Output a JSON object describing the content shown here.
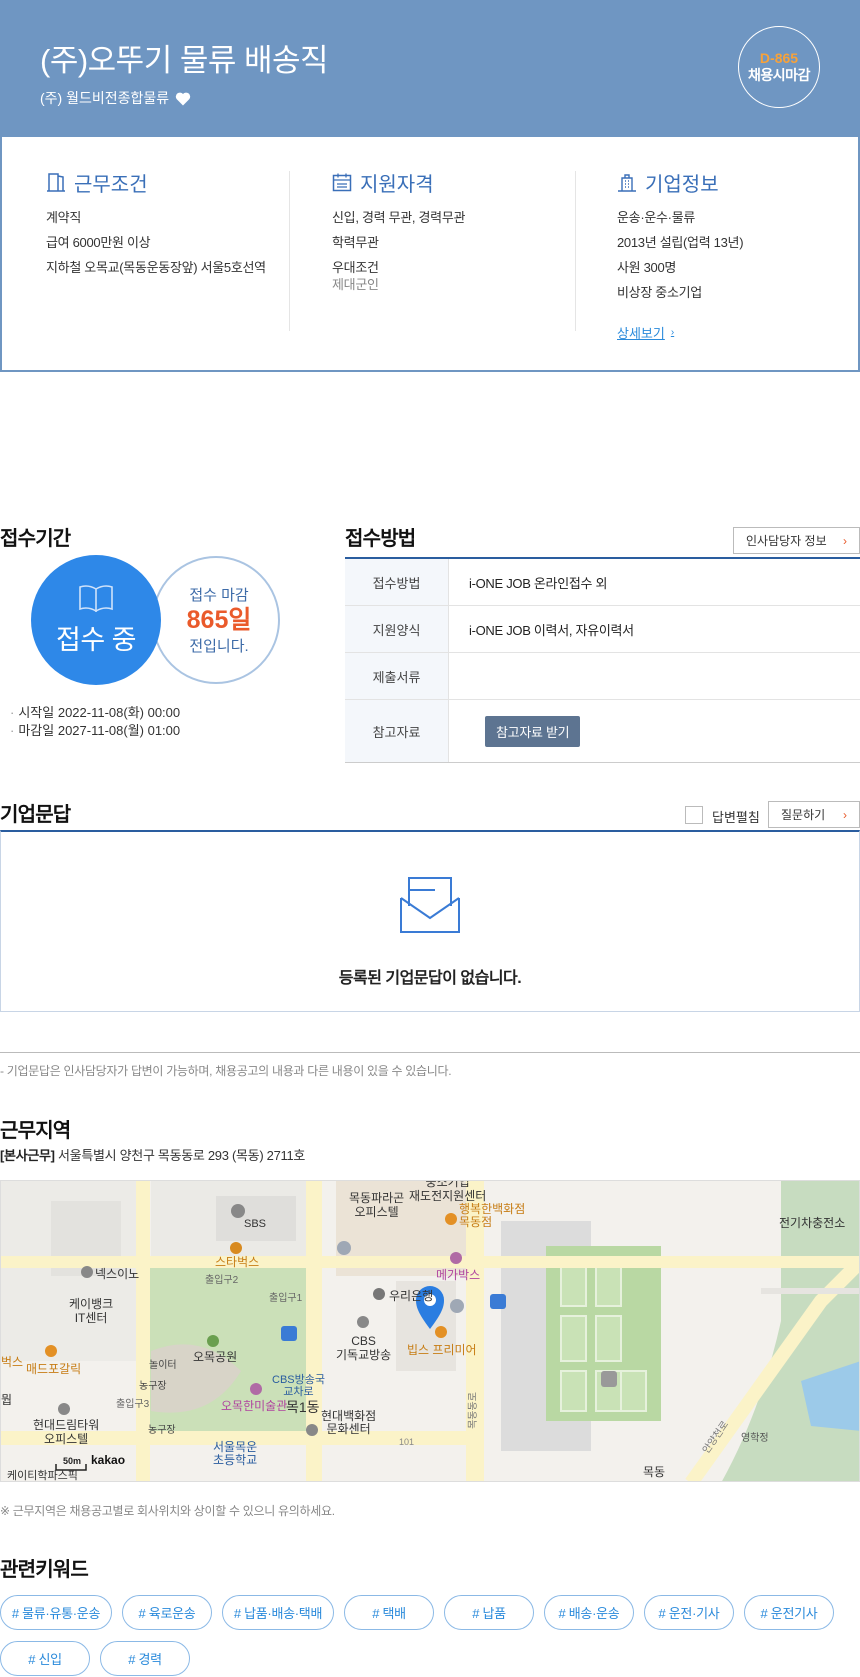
{
  "header": {
    "title": "(주)오뚜기 물류 배송직",
    "company": "(주) 월드비전종합물류",
    "dday_num": "D-865",
    "dday_text": "채용시마감"
  },
  "info": {
    "work": {
      "heading": "근무조건",
      "lines": [
        "계약직",
        "급여 6000만원 이상",
        "지하철 오목교(목동운동장앞) 서울5호선역"
      ]
    },
    "qual": {
      "heading": "지원자격",
      "lines": [
        "신입, 경력 무관, 경력무관",
        "학력무관",
        "우대조건"
      ],
      "sub": "제대군인"
    },
    "company": {
      "heading": "기업정보",
      "lines": [
        "운송·운수·물류",
        "2013년 설립(업력 13년)",
        "사원 300명",
        "비상장 중소기업"
      ],
      "more": "상세보기"
    }
  },
  "period": {
    "title": "접수기간",
    "status": "접수 중",
    "deadline_a": "접수 마감",
    "deadline_days": "865일",
    "deadline_c": "전입니다.",
    "start": "시작일 2022-11-08(화) 00:00",
    "end": "마감일 2027-11-08(월) 01:00"
  },
  "method": {
    "title": "접수방법",
    "hr_button": "인사담당자 정보",
    "rows": [
      {
        "label": "접수방법",
        "value": "i-ONE JOB 온라인접수 외"
      },
      {
        "label": "지원양식",
        "value": "i-ONE JOB 이력서, 자유이력서"
      },
      {
        "label": "제출서류",
        "value": ""
      },
      {
        "label": "참고자료",
        "button": "참고자료 받기"
      }
    ]
  },
  "qa": {
    "title": "기업문답",
    "toggle_label": "답변펼침",
    "ask_button": "질문하기",
    "empty": "등록된 기업문답이 없습니다.",
    "note": "- 기업문답은 인사담당자가 답변이 가능하며, 채용공고의 내용과 다른 내용이 있을 수 있습니다."
  },
  "location": {
    "title": "근무지역",
    "addr_tag": "[본사근무]",
    "addr": "서울특별시 양천구 목동동로 293 (목동) 2711호",
    "note": "※ 근무지역은 채용공고별로 회사위치와 상이할 수 있으니 유의하세요.",
    "map_labels": {
      "sbs": "SBS",
      "starbucks": "스타벅스",
      "exit2": "출입구2",
      "exit1": "출입구1",
      "nexon": "넥스이노",
      "kbank_a": "케이뱅크",
      "kbank_b": "IT센터",
      "park": "오목공원",
      "playground": "놀이터",
      "court": "농구장",
      "court2": "농구장",
      "exit3": "출입구3",
      "mcd": "매드포갈릭",
      "hyundai_tw_a": "현대드림타워",
      "hyundai_tw_b": "오피스텔",
      "museum": "오목한미술관",
      "mok1": "목1동",
      "cbs_a": "CBS",
      "cbs_b": "기독교방송",
      "cbs_ex_a": "CBS방송국",
      "cbs_ex_b": "교차로",
      "woori": "우리은행",
      "vips": "빕스 프리미어",
      "paragon_a": "목동파라곤",
      "paragon_b": "오피스텔",
      "sme_a": "중소기업",
      "sme_b": "재도전지원센터",
      "happy_a": "행복한백화점",
      "happy_b": "목동점",
      "megabox": "메가박스",
      "hyundai_dept_a": "현대백화점",
      "hyundai_dept_b": "문화센터",
      "school_a": "서울목운",
      "school_b": "초등학교",
      "mokdong_road": "목동동로",
      "charge": "전기차충전소",
      "inan": "안양천로",
      "yeonghak": "영학정",
      "mokdong": "목동",
      "kt": "케이티학파스픽",
      "b101": "101",
      "scale": "50m",
      "kakao": "kakao",
      "edge_a": "벅스",
      "edge_b": "뭡"
    }
  },
  "keywords": {
    "title": "관련키워드",
    "items": [
      "# 물류·유통·운송",
      "# 육로운송",
      "# 납품·배송·택배",
      "# 택배",
      "# 납품",
      "# 배송·운송",
      "# 운전·기사",
      "# 운전기사",
      "# 신입",
      "# 경력"
    ]
  }
}
